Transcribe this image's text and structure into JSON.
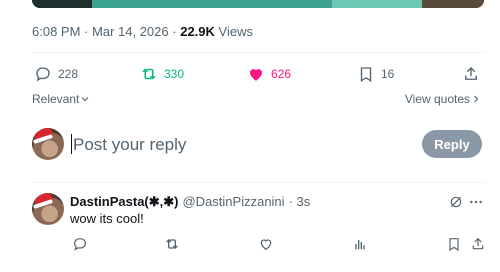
{
  "post": {
    "time": "6:08 PM",
    "separator": "·",
    "date": "Mar 14, 2026",
    "views_count": "22.9K",
    "views_label": "Views"
  },
  "actions": {
    "replies": "228",
    "reposts": "330",
    "likes": "626",
    "bookmarks": "16"
  },
  "sort": {
    "label": "Relevant",
    "view_quotes": "View quotes"
  },
  "compose": {
    "placeholder": "Post your reply",
    "button": "Reply"
  },
  "reply": {
    "name": "DastinPasta(✱,✱)",
    "handle": "@DastinPizzanini",
    "time": "· 3s",
    "text": "wow its cool!"
  },
  "colors": {
    "repost": "#00ba7c",
    "like": "#f91880",
    "secondary_text": "#536471",
    "reply_button_disabled": "#8b98a5"
  },
  "icons": [
    "reply-icon",
    "repost-icon",
    "heart-icon",
    "bookmark-icon",
    "share-icon",
    "chevron-down-icon",
    "chevron-right-icon",
    "grok-icon",
    "more-icon",
    "views-icon"
  ]
}
